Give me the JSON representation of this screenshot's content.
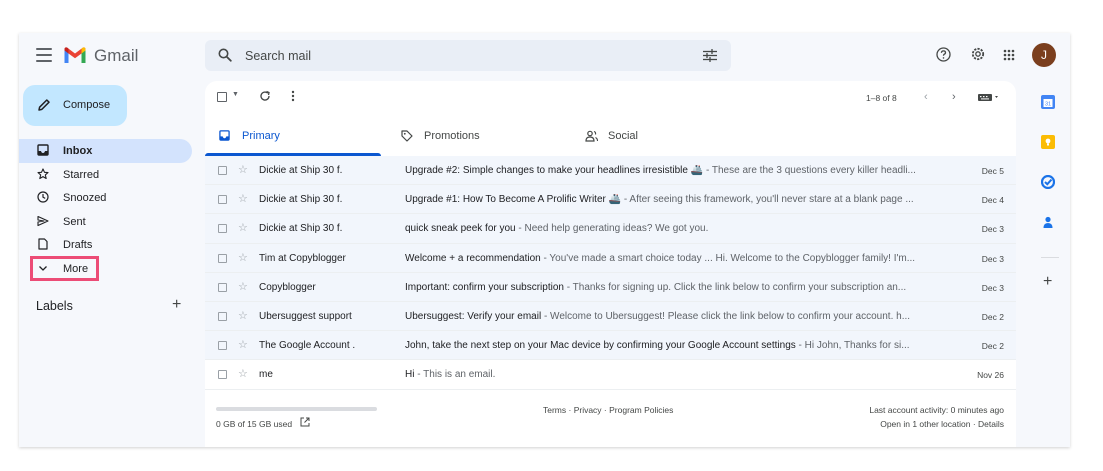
{
  "app": {
    "brand": "Gmail",
    "avatar_letter": "J",
    "avatar_color": "#7b3f1e",
    "accent": "#0b57d0"
  },
  "search": {
    "placeholder": "Search mail",
    "filter_icon": "tune-icon"
  },
  "header_icons": [
    "help-icon",
    "settings-icon",
    "apps-grid-icon"
  ],
  "compose_label": "Compose",
  "nav": [
    {
      "label": "Inbox",
      "icon": "inbox-icon",
      "active": true
    },
    {
      "label": "Starred",
      "icon": "star-icon"
    },
    {
      "label": "Snoozed",
      "icon": "clock-icon"
    },
    {
      "label": "Sent",
      "icon": "send-icon"
    },
    {
      "label": "Drafts",
      "icon": "draft-icon"
    },
    {
      "label": "More",
      "icon": "chevron-down-icon",
      "highlighted": true
    }
  ],
  "labels": {
    "title": "Labels",
    "add": "+"
  },
  "toolbar": {
    "count": "1–8 of 8",
    "prev": "‹",
    "next": "›"
  },
  "tabs": [
    {
      "label": "Primary",
      "icon": "inbox-icon",
      "active": true
    },
    {
      "label": "Promotions",
      "icon": "tag-icon"
    },
    {
      "label": "Social",
      "icon": "people-icon"
    }
  ],
  "emails": [
    {
      "sender": "Dickie at Ship 30 f.",
      "subject": "Upgrade #2: Simple changes to make your headlines irresistible 🚢",
      "snippet": " - These are the 3 questions every killer headli...",
      "date": "Dec 5"
    },
    {
      "sender": "Dickie at Ship 30 f.",
      "subject": "Upgrade #1: How To Become A Prolific Writer 🚢",
      "snippet": " - After seeing this framework, you'll never stare at a blank page ...",
      "date": "Dec 4"
    },
    {
      "sender": "Dickie at Ship 30 f.",
      "subject": "quick sneak peek for you",
      "snippet": " - Need help generating ideas? We got you.",
      "date": "Dec 3"
    },
    {
      "sender": "Tim at Copyblogger",
      "subject": "Welcome + a recommendation",
      "snippet": " - You've made a smart choice today ... Hi. Welcome to the Copyblogger family! I'm...",
      "date": "Dec 3"
    },
    {
      "sender": "Copyblogger",
      "subject": "Important: confirm your subscription",
      "snippet": " - Thanks for signing up. Click the link below to confirm your subscription an...",
      "date": "Dec 3"
    },
    {
      "sender": "Ubersuggest support",
      "subject": "Ubersuggest: Verify your email",
      "snippet": " - Welcome to Ubersuggest! Please click the link below to confirm your account. h...",
      "date": "Dec 2"
    },
    {
      "sender": "The Google Account .",
      "subject": "John, take the next step on your Mac device by confirming your Google Account settings",
      "snippet": " - Hi John, Thanks for si...",
      "date": "Dec 2"
    },
    {
      "sender": "me",
      "subject": "Hi",
      "snippet": " - This is an email.",
      "date": "Nov 26",
      "unread": true
    }
  ],
  "footer": {
    "storage": "0 GB of 15 GB used",
    "policies": "Terms · Privacy · Program Policies",
    "activity": "Last account activity: 0 minutes ago",
    "details": "Open in 1 other location · Details"
  },
  "side_panel": [
    "calendar-icon",
    "keep-icon",
    "tasks-icon",
    "contacts-icon"
  ],
  "side_add": "+"
}
